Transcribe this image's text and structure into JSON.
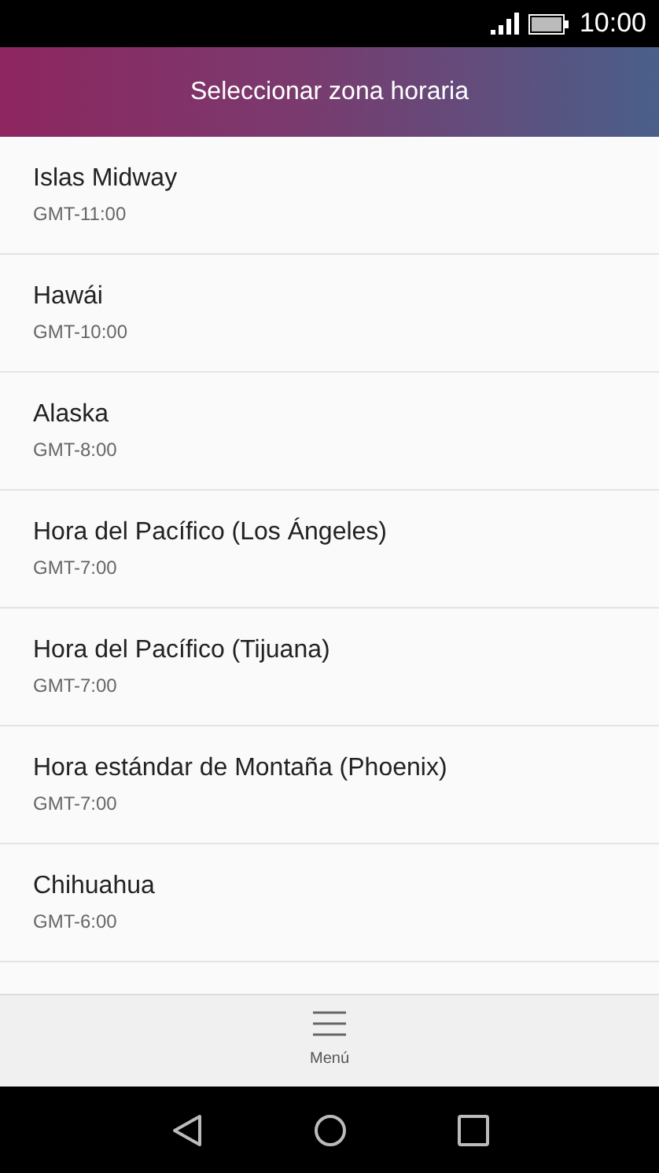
{
  "status_bar": {
    "time": "10:00"
  },
  "header": {
    "title": "Seleccionar zona horaria"
  },
  "time_zones": [
    {
      "name": "Islas Midway",
      "offset": "GMT-11:00"
    },
    {
      "name": "Hawái",
      "offset": "GMT-10:00"
    },
    {
      "name": "Alaska",
      "offset": "GMT-8:00"
    },
    {
      "name": "Hora del Pacífico (Los Ángeles)",
      "offset": "GMT-7:00"
    },
    {
      "name": "Hora del Pacífico (Tijuana)",
      "offset": "GMT-7:00"
    },
    {
      "name": "Hora estándar de Montaña (Phoenix)",
      "offset": "GMT-7:00"
    },
    {
      "name": "Chihuahua",
      "offset": "GMT-6:00"
    }
  ],
  "bottom_bar": {
    "label": "Menú"
  }
}
